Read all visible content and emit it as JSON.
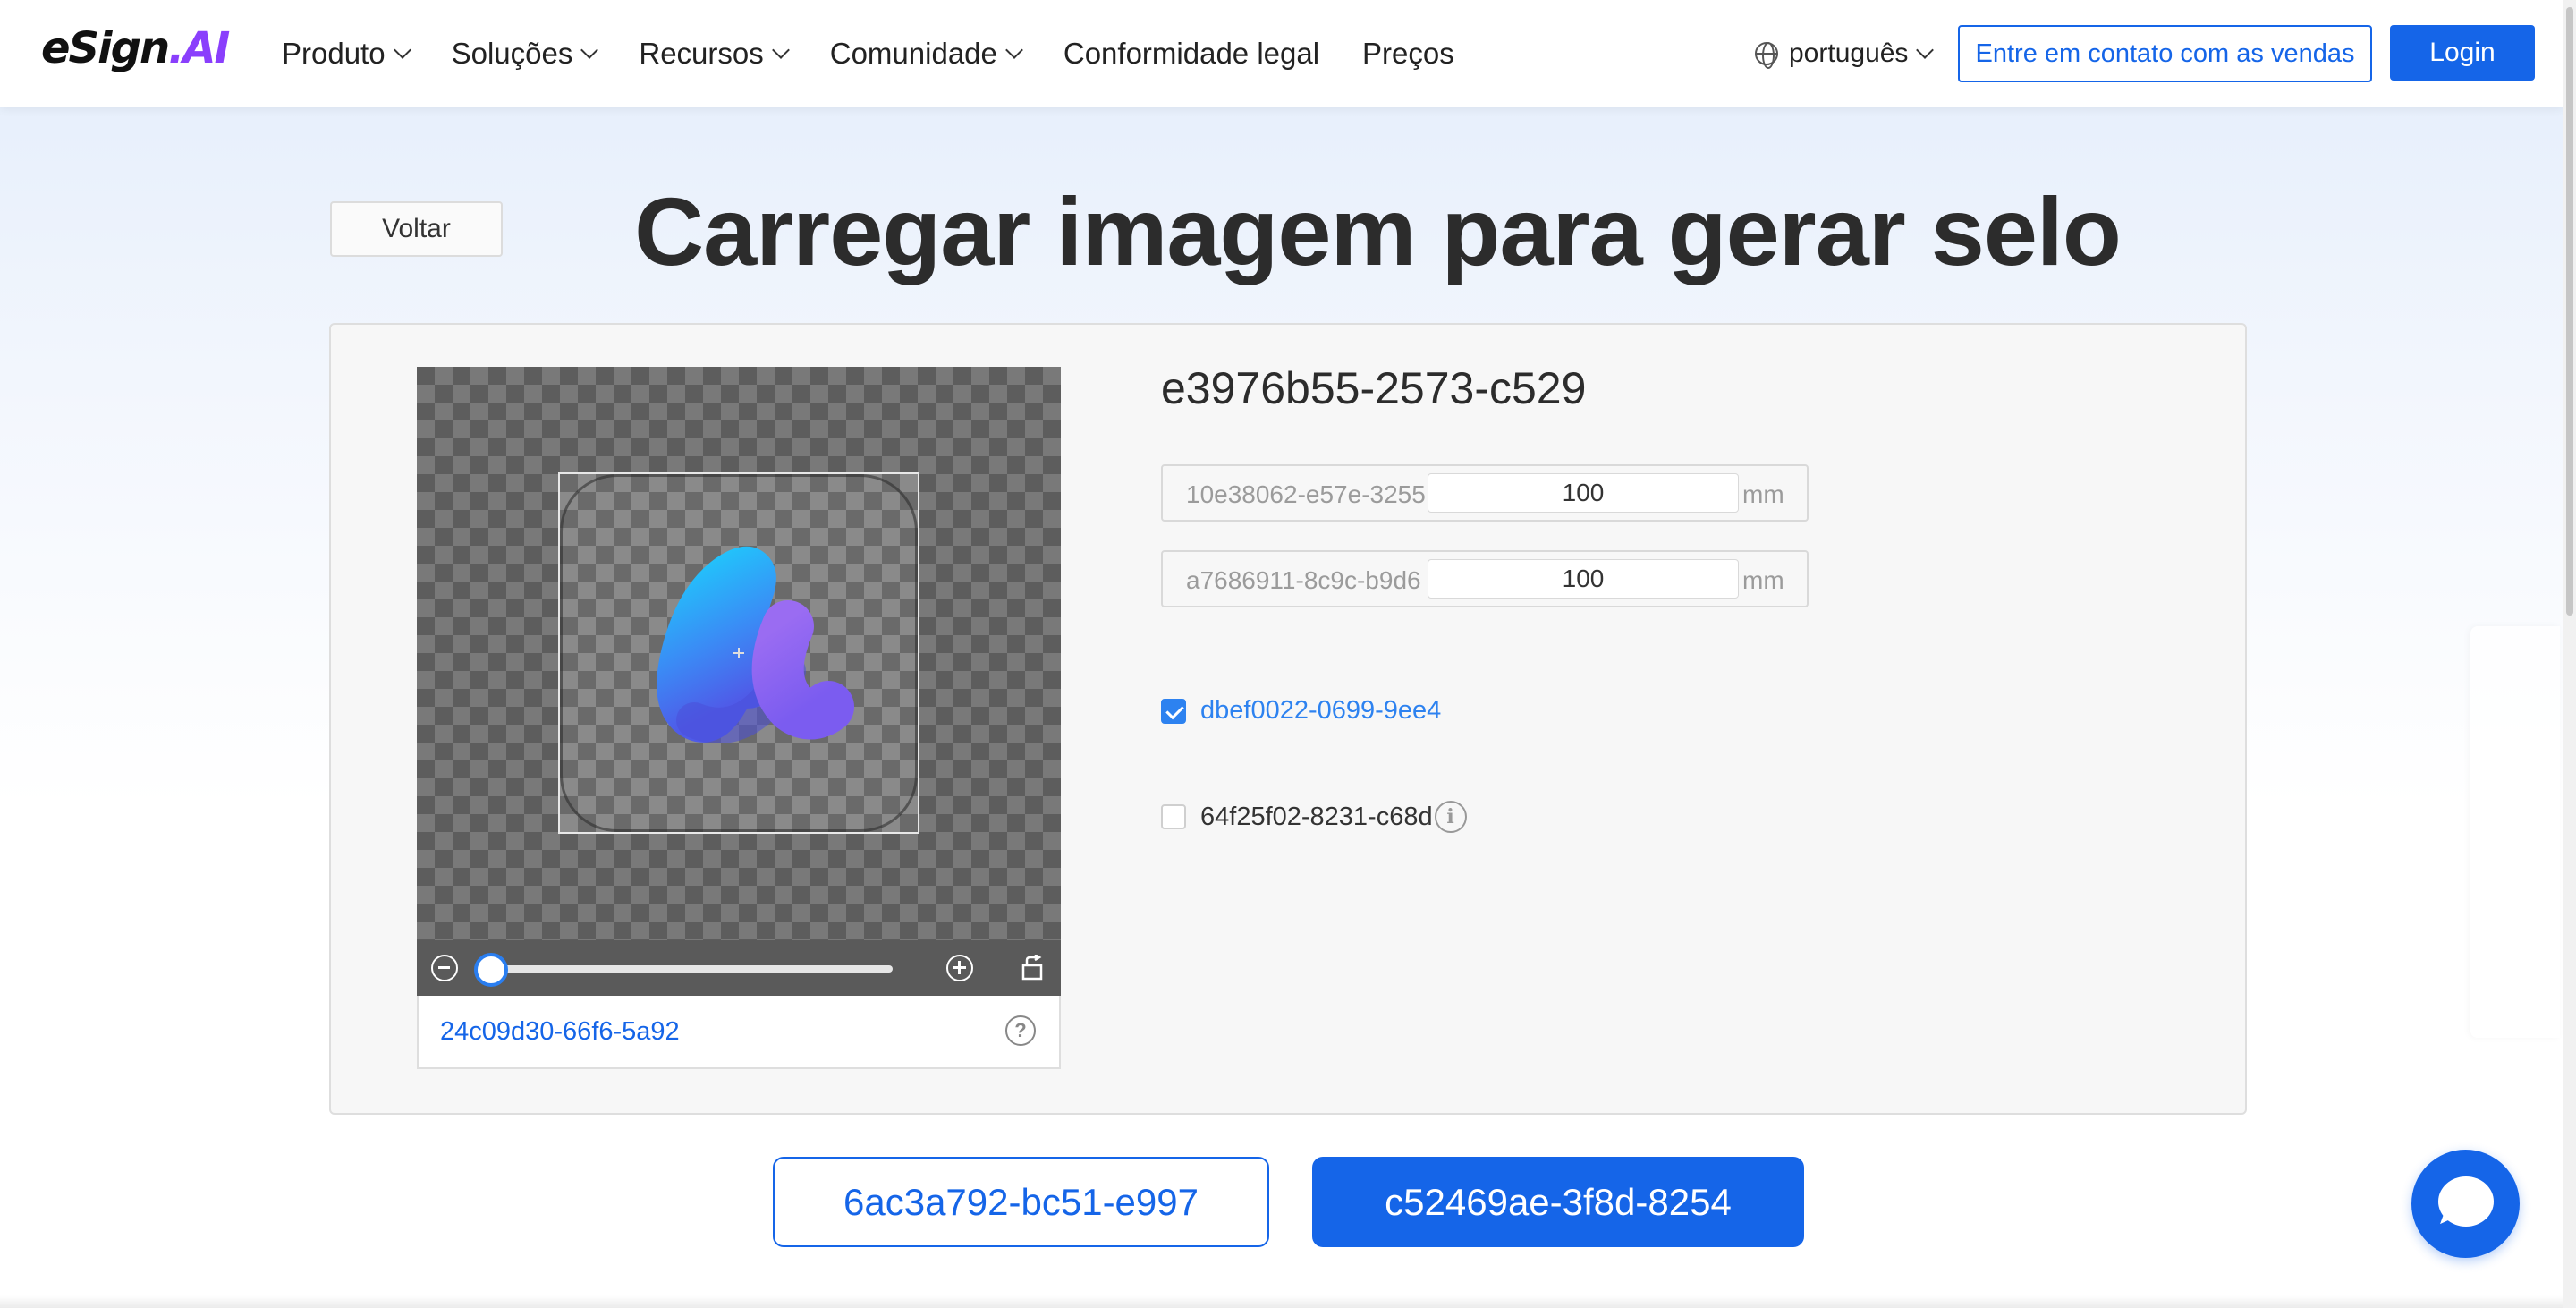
{
  "header": {
    "logo_main": "eSign",
    "logo_dot": ".",
    "logo_ai": "AI",
    "nav": [
      {
        "label": "Produto",
        "has_dropdown": true
      },
      {
        "label": "Soluções",
        "has_dropdown": true
      },
      {
        "label": "Recursos",
        "has_dropdown": true
      },
      {
        "label": "Comunidade",
        "has_dropdown": true
      },
      {
        "label": "Conformidade legal",
        "has_dropdown": false
      },
      {
        "label": "Preços",
        "has_dropdown": false
      }
    ],
    "language": "português",
    "contact_sales": "Entre em contato com as vendas",
    "login": "Login"
  },
  "page": {
    "back_label": "Voltar",
    "title": "Carregar imagem para gerar selo"
  },
  "crop": {
    "zoom_level_fraction": 0.0,
    "footer_link": "24c09d30-66f6-5a92"
  },
  "form": {
    "asset_title": "e3976b55-2573-c529",
    "width_label": "10e38062-e57e-3255",
    "width_value": "100",
    "height_label": "a7686911-8c9c-b9d6",
    "height_value": "100",
    "unit": "mm",
    "option1_label": "dbef0022-0699-9ee4",
    "option1_checked": true,
    "option2_label": "64f25f02-8231-c68d",
    "option2_checked": false,
    "info_glyph": "i"
  },
  "actions": {
    "secondary": "6ac3a792-bc51-e997",
    "primary": "c52469ae-3f8d-8254"
  },
  "colors": {
    "accent": "#1565e8",
    "checkbox": "#2d82f0",
    "logo_ai": "#8a3ffc"
  },
  "icons": [
    "globe-icon",
    "chevron-down-icon",
    "zoom-out-icon",
    "zoom-in-icon",
    "rotate-icon",
    "help-icon",
    "info-icon",
    "chat-icon"
  ]
}
